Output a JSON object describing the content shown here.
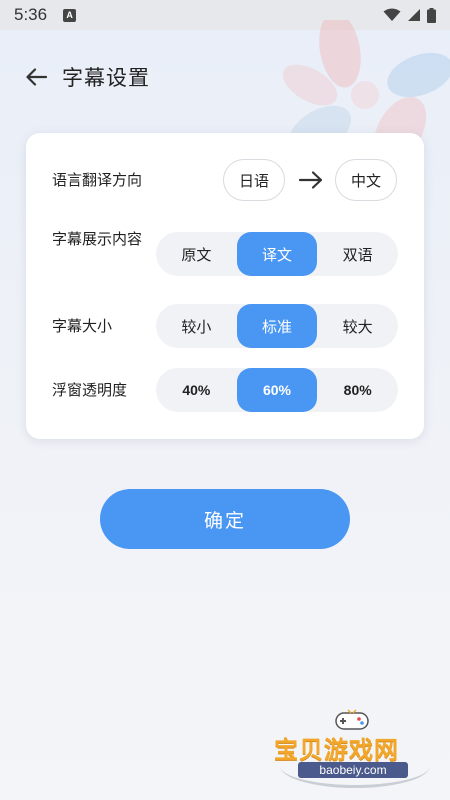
{
  "status_bar": {
    "time": "5:36",
    "badge": "A",
    "icons": [
      "wifi-icon",
      "signal-icon",
      "battery-icon"
    ]
  },
  "header": {
    "title": "字幕设置",
    "back_icon": "arrow-left-icon"
  },
  "settings": {
    "direction": {
      "label": "语言翻译方向",
      "source": "日语",
      "target": "中文",
      "arrow_icon": "arrow-right-icon"
    },
    "content": {
      "label": "字幕展示内容",
      "options": [
        "原文",
        "译文",
        "双语"
      ],
      "selected": "译文"
    },
    "size": {
      "label": "字幕大小",
      "options": [
        "较小",
        "标准",
        "较大"
      ],
      "selected": "标准"
    },
    "opacity": {
      "label": "浮窗透明度",
      "options": [
        "40%",
        "60%",
        "80%"
      ],
      "selected": "60%"
    }
  },
  "confirm_button": "确定",
  "watermark": {
    "text": "宝贝游戏网",
    "url": "baobeiy.com"
  },
  "colors": {
    "accent": "#4a97f3",
    "segment_bg": "#f1f2f5",
    "card_bg": "#ffffff"
  }
}
